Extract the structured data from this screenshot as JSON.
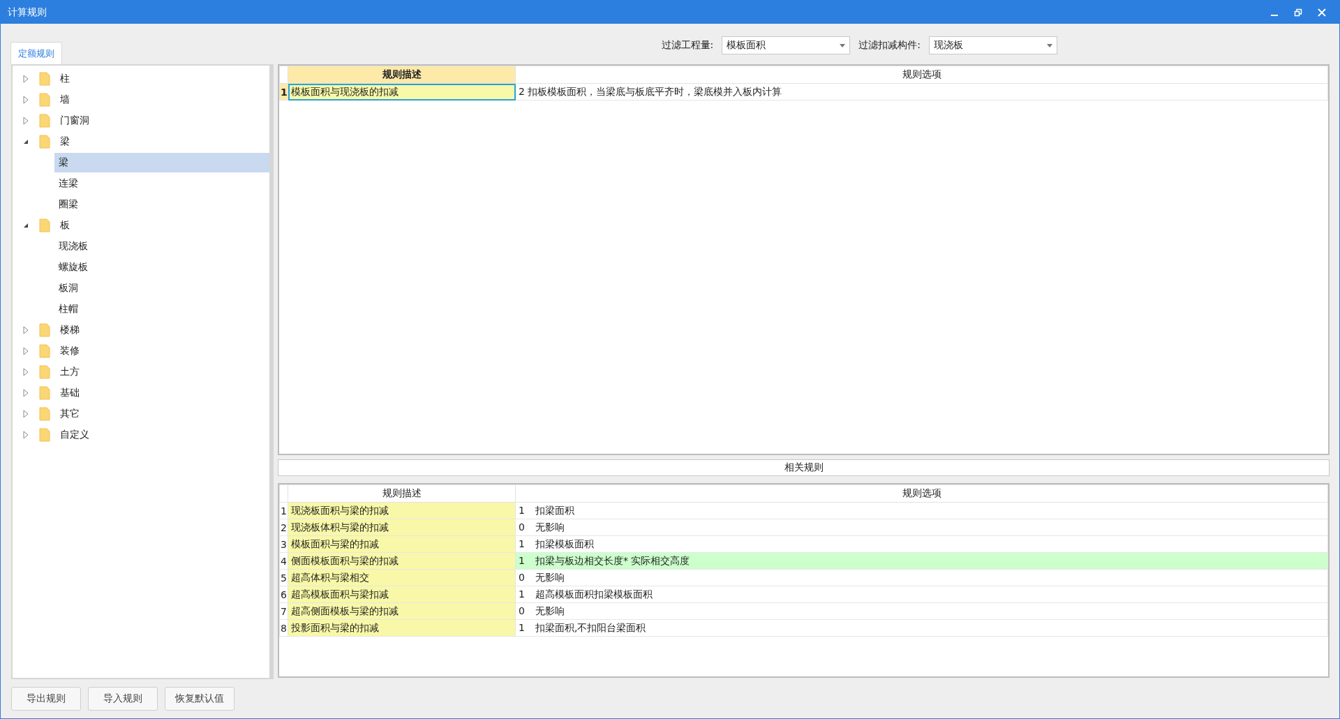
{
  "window": {
    "title": "计算规则"
  },
  "tabs": [
    {
      "label": "定额规则",
      "selected": true
    }
  ],
  "filters": [
    {
      "label": "过滤工程量:",
      "value": "模板面积"
    },
    {
      "label": "过滤扣减构件:",
      "value": "现浇板"
    }
  ],
  "tree": [
    {
      "label": "柱",
      "expanded": false,
      "selected": false
    },
    {
      "label": "墙",
      "expanded": false,
      "selected": false
    },
    {
      "label": "门窗洞",
      "expanded": false,
      "selected": false
    },
    {
      "label": "梁",
      "expanded": true,
      "selected": false,
      "children": [
        {
          "label": "梁",
          "selected": true
        },
        {
          "label": "连梁",
          "selected": false
        },
        {
          "label": "圈梁",
          "selected": false
        }
      ]
    },
    {
      "label": "板",
      "expanded": true,
      "selected": false,
      "children": [
        {
          "label": "现浇板",
          "selected": false
        },
        {
          "label": "螺旋板",
          "selected": false
        },
        {
          "label": "板洞",
          "selected": false
        },
        {
          "label": "柱帽",
          "selected": false
        }
      ]
    },
    {
      "label": "楼梯",
      "expanded": false,
      "selected": false
    },
    {
      "label": "装修",
      "expanded": false,
      "selected": false
    },
    {
      "label": "土方",
      "expanded": false,
      "selected": false
    },
    {
      "label": "基础",
      "expanded": false,
      "selected": false
    },
    {
      "label": "其它",
      "expanded": false,
      "selected": false
    },
    {
      "label": "自定义",
      "expanded": false,
      "selected": false
    }
  ],
  "rules_table": {
    "columns": [
      "规则描述",
      "规则选项"
    ],
    "rows": [
      {
        "index": "1",
        "description": "模板面积与现浇板的扣减",
        "option": "2 扣板模板面积，当梁底与板底平齐时，梁底模并入板内计算",
        "selected": true
      }
    ]
  },
  "related_title": "相关规则",
  "related_table": {
    "columns": [
      "规则描述",
      "规则选项"
    ],
    "rows": [
      {
        "index": "1",
        "description": "现浇板面积与梁的扣减",
        "code": "1",
        "option": "扣梁面积",
        "selected": false
      },
      {
        "index": "2",
        "description": "现浇板体积与梁的扣减",
        "code": "0",
        "option": "无影响",
        "selected": false
      },
      {
        "index": "3",
        "description": "模板面积与梁的扣减",
        "code": "1",
        "option": "扣梁模板面积",
        "selected": false
      },
      {
        "index": "4",
        "description": "侧面模板面积与梁的扣减",
        "code": "1",
        "option": "扣梁与板边相交长度* 实际相交高度",
        "selected": true
      },
      {
        "index": "5",
        "description": "超高体积与梁相交",
        "code": "0",
        "option": "无影响",
        "selected": false
      },
      {
        "index": "6",
        "description": "超高模板面积与梁扣减",
        "code": "1",
        "option": "超高模板面积扣梁模板面积",
        "selected": false
      },
      {
        "index": "7",
        "description": "超高侧面模板与梁的扣减",
        "code": "0",
        "option": "无影响",
        "selected": false
      },
      {
        "index": "8",
        "description": "投影面积与梁的扣减",
        "code": "1",
        "option": "扣梁面积,不扣阳台梁面积",
        "selected": false
      }
    ]
  },
  "buttons": [
    "导出规则",
    "导入规则",
    "恢复默认值"
  ]
}
